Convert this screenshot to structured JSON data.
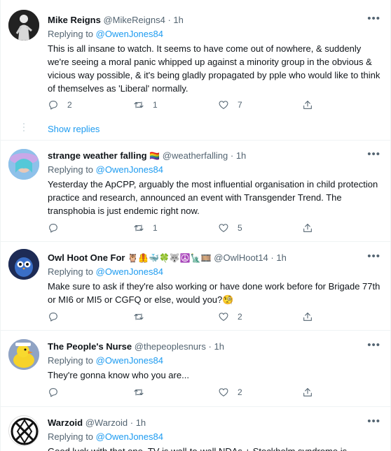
{
  "tweets": [
    {
      "name": "Mike Reigns",
      "name_emoji": "",
      "handle": "@MikeReigns4",
      "dot": "·",
      "time": "1h",
      "reply_prefix": "Replying to",
      "reply_to": "@OwenJones84",
      "text": "This is all insane to watch. It seems to have come out of nowhere, & suddenly we're seeing a moral panic whipped up against a minority group in the obvious & vicious way possible, & it's being gladly propagated by pple who would like to think of themselves as 'Liberal' normally.",
      "replies": "2",
      "retweets": "1",
      "likes": "7",
      "show_replies": "Show replies"
    },
    {
      "name": "strange weather falling",
      "name_emoji": "🏳️‍🌈",
      "handle": "@weatherfalling",
      "dot": "·",
      "time": "1h",
      "reply_prefix": "Replying to",
      "reply_to": "@OwenJones84",
      "text": "Yesterday the ApCPP, arguably the most influential organisation in child protection practice and research, announced an event with Transgender Trend. The transphobia is just endemic right now.",
      "replies": "",
      "retweets": "1",
      "likes": "5"
    },
    {
      "name": "Owl Hoot One For",
      "name_emoji": "🦉🦺🐳🍀🐺☮️🗽🎞️",
      "handle": "@OwlHoot14",
      "dot": "·",
      "time": "1h",
      "reply_prefix": "Replying to",
      "reply_to": "@OwenJones84",
      "text": "Make sure to ask if they're also working or have done work before for Brigade 77th or MI6 or MI5 or CGFQ or else, would you?🧐",
      "replies": "",
      "retweets": "",
      "likes": "2"
    },
    {
      "name": "The People's Nurse",
      "name_emoji": "",
      "handle": "@thepeoplesnurs",
      "dot": "·",
      "time": "1h",
      "reply_prefix": "Replying to",
      "reply_to": "@OwenJones84",
      "text": "They're gonna know who you are...",
      "replies": "",
      "retweets": "",
      "likes": "2"
    },
    {
      "name": "Warzoid",
      "name_emoji": "",
      "handle": "@Warzoid",
      "dot": "·",
      "time": "1h",
      "reply_prefix": "Replying to",
      "reply_to": "@OwenJones84",
      "text": "Good luck with that one. TV is wall-to-wall NDAs + Stockholm syndrome is"
    }
  ],
  "more_icon": "more-horizontal-icon",
  "colors": {
    "link": "#1d9bf0",
    "secondary": "#536471",
    "border": "#eff3f4"
  }
}
